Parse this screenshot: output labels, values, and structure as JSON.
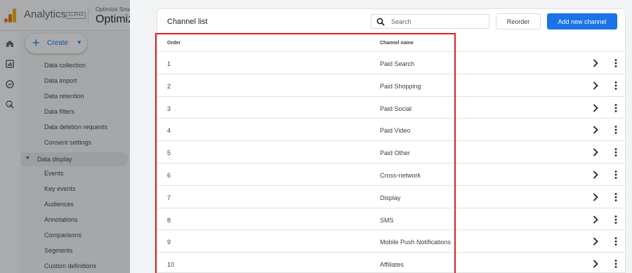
{
  "header": {
    "app_name": "Analytics",
    "badge": "ALPHA",
    "account_small": "Optimize Sma",
    "account_big": "Optimiz"
  },
  "rail_icons": [
    "home-icon",
    "reports-icon",
    "explore-icon",
    "advertising-icon"
  ],
  "create": {
    "label": "Create"
  },
  "left_nav": {
    "items_top": [
      "Data collection",
      "Data import",
      "Data retention",
      "Data filters",
      "Data deletion requests",
      "Consent settings"
    ],
    "section": "Data display",
    "items_bottom": [
      "Events",
      "Key events",
      "Audiences",
      "Annotations",
      "Comparisons",
      "Segments",
      "Custom definitions"
    ]
  },
  "card": {
    "title": "Channel list",
    "search_placeholder": "Search",
    "reorder_label": "Reorder",
    "add_label": "Add new channel"
  },
  "table": {
    "columns": [
      "Order",
      "Channel name"
    ],
    "rows": [
      {
        "order": "1",
        "name": "Paid Search"
      },
      {
        "order": "2",
        "name": "Paid Shopping"
      },
      {
        "order": "3",
        "name": "Paid Social"
      },
      {
        "order": "4",
        "name": "Paid Video"
      },
      {
        "order": "5",
        "name": "Paid Other"
      },
      {
        "order": "6",
        "name": "Cross-network"
      },
      {
        "order": "7",
        "name": "Display"
      },
      {
        "order": "8",
        "name": "SMS"
      },
      {
        "order": "9",
        "name": "Mobile Push Notifications"
      },
      {
        "order": "10",
        "name": "Affiliates"
      }
    ]
  },
  "colors": {
    "accent": "#1a73e8",
    "highlight": "#e0201f",
    "logo": [
      "#f9ab00",
      "#e37400",
      "#e37400"
    ]
  }
}
